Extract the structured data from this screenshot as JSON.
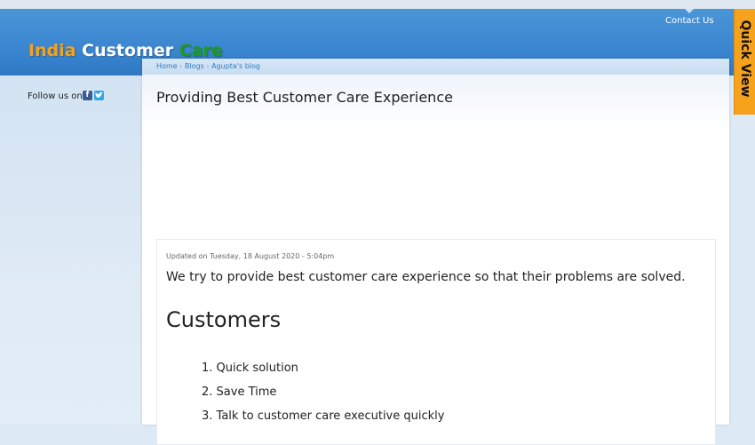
{
  "site": {
    "logo_part1": "India",
    "logo_part2": "Customer",
    "logo_part3": "Care",
    "contact_label": "Contact Us",
    "quick_view_label": "Quick View"
  },
  "sidebar": {
    "follow_label": "Follow us on:",
    "social_icons": [
      "facebook-icon",
      "twitter-icon"
    ]
  },
  "breadcrumb": {
    "items": [
      "Home",
      "Blogs",
      "Agupta's blog"
    ],
    "separator": "›"
  },
  "page": {
    "title": "Providing Best Customer Care Experience",
    "updated": "Updated on Tuesday, 18 August 2020 - 5:04pm",
    "intro": "We try to provide best customer care experience so that their problems are solved.",
    "heading": "Customers",
    "list": [
      "1. Quick solution",
      "2. Save Time",
      "3. Talk to customer care executive quickly"
    ]
  },
  "colors": {
    "header_blue": "#3a86cf",
    "brand_orange": "#f7a21b",
    "brand_green": "#1e9a1e",
    "link_blue": "#2f7bc6"
  }
}
